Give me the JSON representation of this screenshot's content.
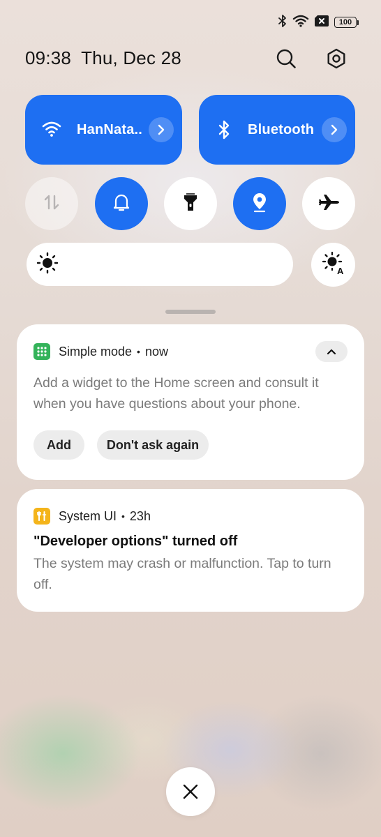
{
  "status_bar": {
    "icons": [
      "bluetooth-icon",
      "wifi-icon",
      "sim-off-icon",
      "battery-icon"
    ],
    "battery_level": "100"
  },
  "header": {
    "time": "09:38",
    "date": "Thu, Dec 28",
    "search_icon": "search-icon",
    "settings_icon": "gear-icon"
  },
  "quick_tiles": {
    "wifi": {
      "label": "HanNata..",
      "icon": "wifi-icon",
      "active": true
    },
    "bluetooth": {
      "label": "Bluetooth",
      "icon": "bluetooth-icon",
      "active": true
    }
  },
  "quick_toggles": [
    {
      "name": "mobile-data",
      "icon": "data-arrows-icon",
      "state": "disabled"
    },
    {
      "name": "ring-mode",
      "icon": "bell-icon",
      "state": "on"
    },
    {
      "name": "flashlight",
      "icon": "flashlight-icon",
      "state": "off"
    },
    {
      "name": "location",
      "icon": "location-pin-icon",
      "state": "on"
    },
    {
      "name": "airplane-mode",
      "icon": "airplane-icon",
      "state": "off"
    }
  ],
  "brightness": {
    "icon": "sun-icon",
    "auto_icon": "auto-brightness-icon"
  },
  "colors": {
    "accent": "#1e6ff2",
    "simple_mode_icon": "#34b35a",
    "system_ui_icon": "#f4b41a"
  },
  "notifications": [
    {
      "app": "Simple mode",
      "separator": "•",
      "time": "now",
      "body": "Add a widget to the Home screen and consult it when you have questions about your phone.",
      "actions": [
        "Add",
        "Don't ask again"
      ],
      "collapse_icon": "chevron-up-icon"
    },
    {
      "app": "System UI",
      "separator": "•",
      "time": "23h",
      "title": "\"Developer options\" turned off",
      "body": "The system may crash or malfunction. Tap to turn off."
    }
  ],
  "close_button": {
    "icon": "close-icon"
  }
}
